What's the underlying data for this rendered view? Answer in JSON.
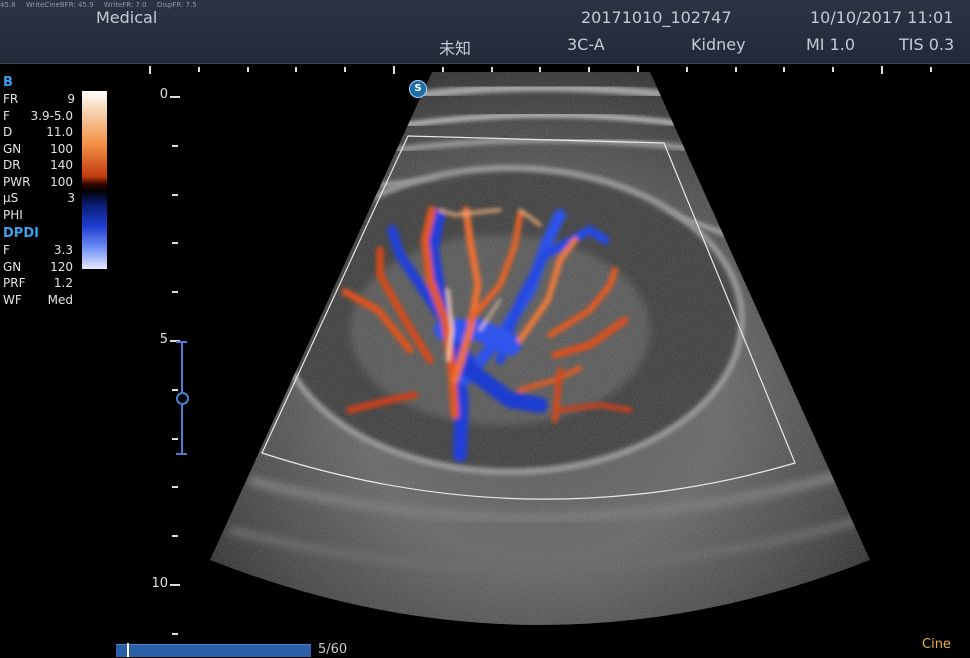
{
  "header": {
    "debug": [
      "45.8",
      "WriteCineBFR: 45.9",
      "WriteFR: 7.0",
      "DispFR: 7.5"
    ],
    "brand": "Medical",
    "study_id": "20171010_102747",
    "datetime": "10/10/2017 11:01",
    "patient": "未知",
    "probe": "3C-A",
    "preset": "Kidney",
    "mi": "MI 1.0",
    "tis": "TIS 0.3"
  },
  "bmode": {
    "title": "B",
    "rows": [
      {
        "k": "FR",
        "v": "9"
      },
      {
        "k": "F",
        "v": "3.9-5.0"
      },
      {
        "k": "D",
        "v": "11.0"
      },
      {
        "k": "GN",
        "v": "100"
      },
      {
        "k": "DR",
        "v": "140"
      },
      {
        "k": "PWR",
        "v": "100"
      },
      {
        "k": "μS",
        "v": "3"
      },
      {
        "k": "PHI",
        "v": ""
      }
    ]
  },
  "dpdi": {
    "title": "DPDI",
    "rows": [
      {
        "k": "F",
        "v": "3.3"
      },
      {
        "k": "GN",
        "v": "120"
      },
      {
        "k": "PRF",
        "v": "1.2"
      },
      {
        "k": "WF",
        "v": "Med"
      }
    ]
  },
  "depth_scale": {
    "labels": [
      "0",
      "5",
      "10"
    ]
  },
  "orientation_marker": "S",
  "cine": {
    "counter": "5/60",
    "label": "Cine",
    "progress": 0.083
  },
  "colors": {
    "accent": "#3aa0e8",
    "cine": "#e6b240",
    "header_bg": "#2b3444"
  }
}
